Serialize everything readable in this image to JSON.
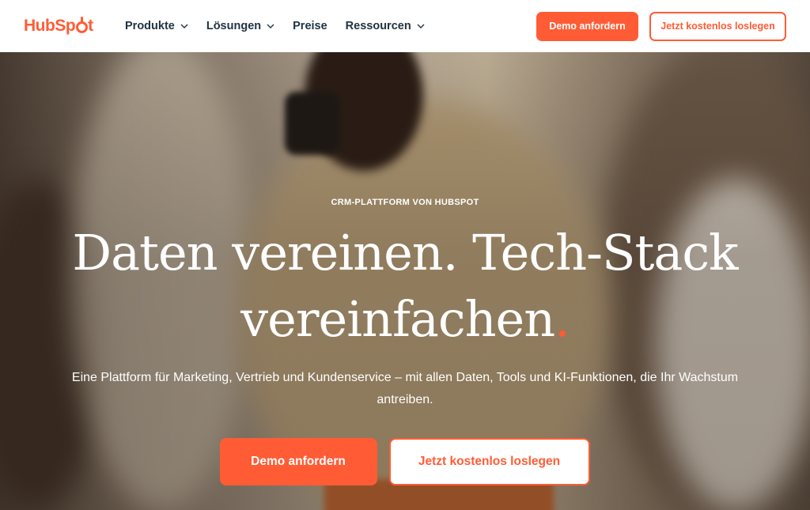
{
  "header": {
    "logo_text_left": "HubSp",
    "logo_text_right": "t",
    "nav": [
      {
        "label": "Produkte",
        "has_dropdown": true
      },
      {
        "label": "Lösungen",
        "has_dropdown": true
      },
      {
        "label": "Preise",
        "has_dropdown": false
      },
      {
        "label": "Ressourcen",
        "has_dropdown": true
      }
    ],
    "demo_label": "Demo anfordern",
    "free_label": "Jetzt kostenlos loslegen"
  },
  "hero": {
    "eyebrow": "CRM-PLATTFORM VON HUBSPOT",
    "headline_line1": "Daten vereinen. Tech-Stack",
    "headline_line2": "vereinfachen",
    "headline_dot": ".",
    "subline": "Eine Plattform für Marketing, Vertrieb und Kundenservice – mit allen Daten, Tools und KI-Funktionen, die Ihr Wachstum antreiben.",
    "demo_label": "Demo anfordern",
    "free_label": "Jetzt kostenlos loslegen"
  },
  "icons": {
    "chevron": "chevron-down-icon"
  },
  "colors": {
    "accent": "#ff5c35",
    "text_dark": "#213343",
    "white": "#ffffff"
  }
}
